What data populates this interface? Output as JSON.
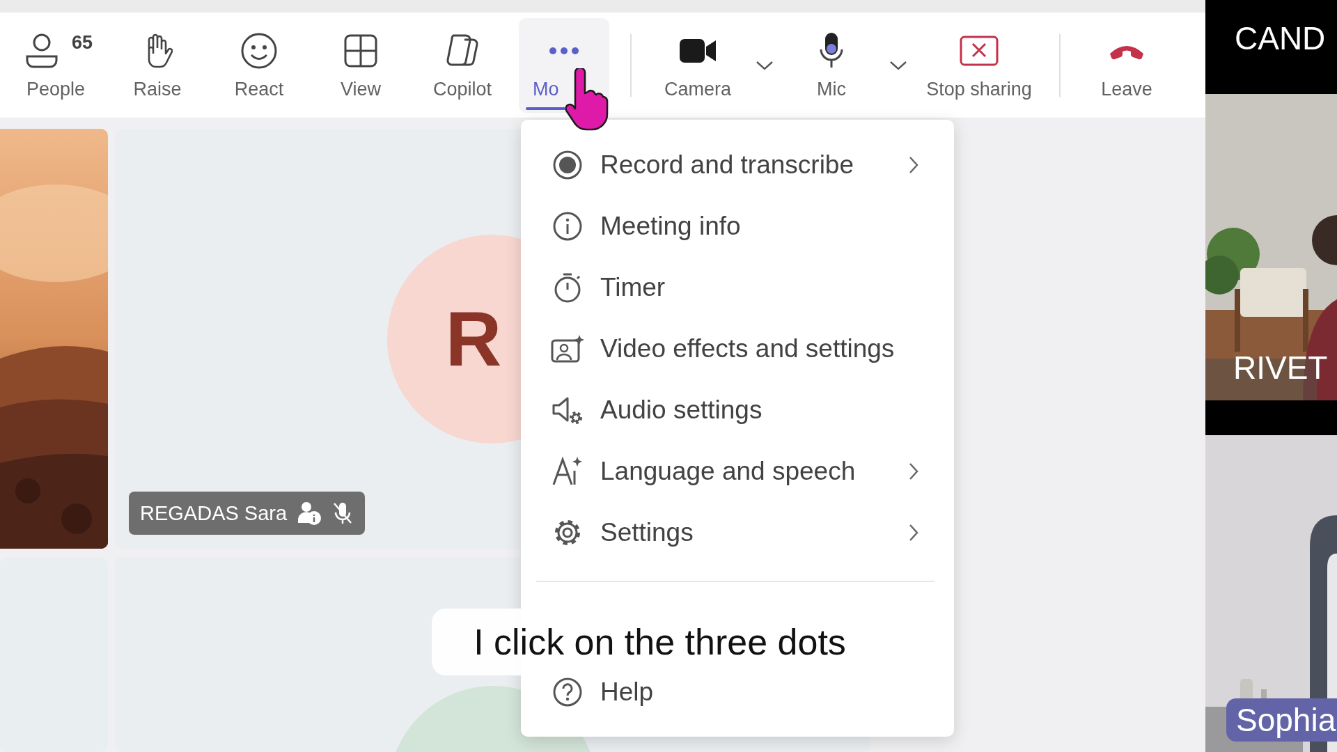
{
  "toolbar": {
    "items": [
      {
        "kind": "button",
        "label": "People",
        "count": "65",
        "selected": false
      },
      {
        "kind": "button",
        "label": "Raise",
        "selected": false
      },
      {
        "kind": "button",
        "label": "React",
        "selected": false
      },
      {
        "kind": "button",
        "label": "View",
        "selected": false
      },
      {
        "kind": "button",
        "label": "Copilot",
        "selected": false
      },
      {
        "kind": "button",
        "label": "Mo",
        "selected": true
      },
      {
        "kind": "divider"
      },
      {
        "kind": "button",
        "label": "Camera",
        "selected": false
      },
      {
        "kind": "chevron"
      },
      {
        "kind": "button",
        "label": "Mic",
        "selected": false
      },
      {
        "kind": "chevron"
      },
      {
        "kind": "button",
        "label": "Stop sharing",
        "selected": false
      },
      {
        "kind": "divider"
      },
      {
        "kind": "button",
        "label": "Leave",
        "selected": false
      }
    ]
  },
  "gallery": {
    "tiles": [
      {
        "kind": "picture"
      },
      {
        "kind": "avatar",
        "initials": "R",
        "name": "REGADAS Sara",
        "color": "#f8d7d0"
      },
      {
        "kind": "blank"
      },
      {
        "kind": "avatar",
        "color": "#d3e4d8"
      }
    ]
  },
  "menu": {
    "items": [
      {
        "kind": "item",
        "label": "Record and transcribe",
        "submenu": true
      },
      {
        "kind": "item",
        "label": "Meeting info",
        "submenu": false
      },
      {
        "kind": "item",
        "label": "Timer",
        "submenu": false
      },
      {
        "kind": "item",
        "label": "Video effects and settings",
        "submenu": false
      },
      {
        "kind": "item",
        "label": "Audio settings",
        "submenu": false
      },
      {
        "kind": "item",
        "label": "Language and speech",
        "submenu": true
      },
      {
        "kind": "item",
        "label": "Settings",
        "submenu": true
      },
      {
        "kind": "separator"
      },
      {
        "kind": "item",
        "label": "Help",
        "submenu": false
      }
    ]
  },
  "side_videos": [
    {
      "kind": "title",
      "name": "CAND"
    },
    {
      "kind": "overlay",
      "name": "RIVET"
    },
    {
      "kind": "badge",
      "name": "Sophia"
    }
  ],
  "caption": "I click on the three dots"
}
